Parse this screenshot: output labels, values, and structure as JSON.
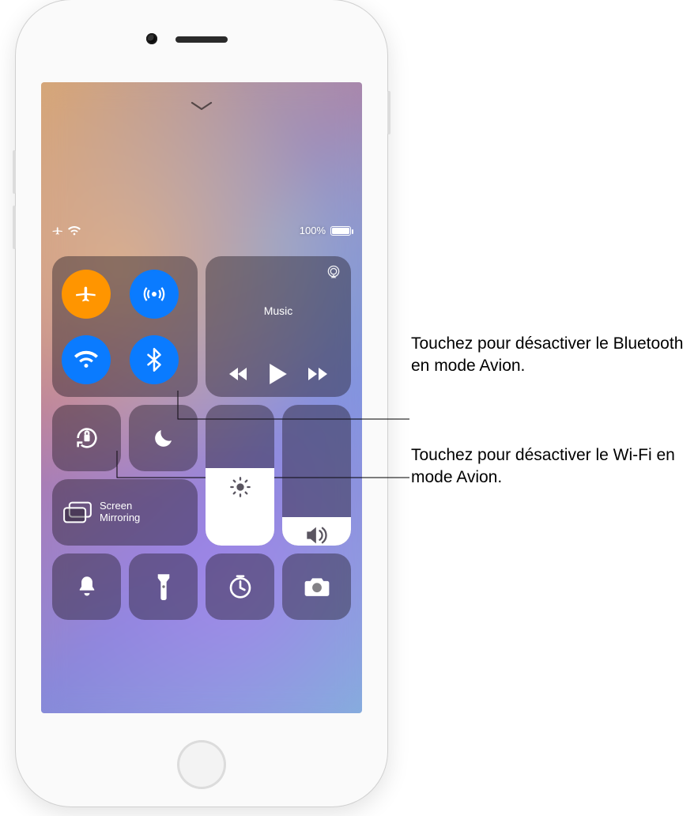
{
  "statusbar": {
    "battery_text": "100%"
  },
  "media": {
    "title": "Music"
  },
  "screen_mirroring": {
    "label": "Screen\nMirroring"
  },
  "sliders": {
    "brightness_pct": 55,
    "volume_pct": 20
  },
  "callouts": {
    "bluetooth": "Touchez pour désactiver le Bluetooth en mode Avion.",
    "wifi": "Touchez pour désactiver le Wi-Fi en mode Avion."
  },
  "icons": {
    "dismiss": "chevron-down-icon",
    "airplane": "airplane-icon",
    "airdrop": "airdrop-icon",
    "wifi": "wifi-icon",
    "bluetooth": "bluetooth-icon",
    "airplay": "airplay-icon",
    "prev": "previous-track-icon",
    "play": "play-icon",
    "next": "next-track-icon",
    "rotation_lock": "rotation-lock-icon",
    "dnd": "do-not-disturb-icon",
    "mirror": "screen-mirroring-icon",
    "brightness": "brightness-icon",
    "volume": "volume-icon",
    "bell": "bell-icon",
    "flashlight": "flashlight-icon",
    "timer": "timer-icon",
    "camera_app": "camera-icon"
  }
}
